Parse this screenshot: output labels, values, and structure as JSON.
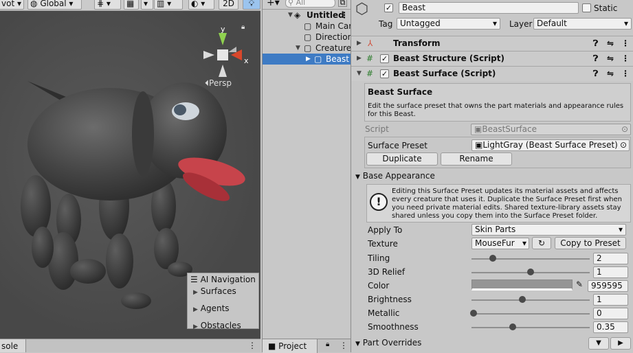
{
  "scene_toolbar": {
    "pivot": "vot",
    "global": "Global",
    "view_2d": "2D"
  },
  "scene_view": {
    "gizmo_x": "x",
    "gizmo_y": "y",
    "persp": "Persp",
    "ai_nav": {
      "title": "AI Navigation",
      "items": [
        "Surfaces",
        "Agents",
        "Obstacles"
      ]
    }
  },
  "console_tab": {
    "label": "sole"
  },
  "hierarchy": {
    "search_placeholder": "All",
    "items": [
      {
        "label": "Untitled"
      },
      {
        "label": "Main Car"
      },
      {
        "label": "Direction"
      },
      {
        "label": "Creature"
      },
      {
        "label": "Beast"
      }
    ],
    "project_tab": "Project"
  },
  "inspector": {
    "object_name": "Beast",
    "static_label": "Static",
    "tag_label": "Tag",
    "tag_value": "Untagged",
    "layer_label": "Layer",
    "layer_value": "Default",
    "components": [
      {
        "label": "Transform"
      },
      {
        "label": "Beast Structure (Script)"
      },
      {
        "label": "Beast Surface (Script)"
      }
    ],
    "surface": {
      "title": "Beast Surface",
      "description": "Edit the surface preset that owns the part materials and appearance rules for this Beast.",
      "script_label": "Script",
      "script_value": "BeastSurface",
      "preset_label": "Surface Preset",
      "preset_value": "LightGray (Beast Surface Preset)",
      "duplicate_label": "Duplicate",
      "rename_label": "Rename"
    },
    "base_appearance": {
      "title": "Base Appearance",
      "warning": "Editing this Surface Preset updates its material assets and affects every creature that uses it. Duplicate the Surface Preset first when you need private material edits. Shared texture-library assets stay shared unless you copy them into the Surface Preset folder.",
      "apply_to_label": "Apply To",
      "apply_to_value": "Skin Parts",
      "texture_label": "Texture",
      "texture_value": "MouseFur",
      "copy_to_preset": "Copy to Preset",
      "tiling_label": "Tiling",
      "tiling_value": "2",
      "tiling_level": 0.18,
      "relief_label": "3D Relief",
      "relief_value": "1",
      "relief_level": 0.5,
      "color_label": "Color",
      "color_value": "959595",
      "color_hex": "#959595",
      "brightness_label": "Brightness",
      "brightness_value": "1",
      "brightness_level": 0.43,
      "metallic_label": "Metallic",
      "metallic_value": "0",
      "metallic_level": 0.02,
      "smoothness_label": "Smoothness",
      "smoothness_value": "0.35",
      "smoothness_level": 0.35
    },
    "part_overrides": "Part Overrides"
  }
}
